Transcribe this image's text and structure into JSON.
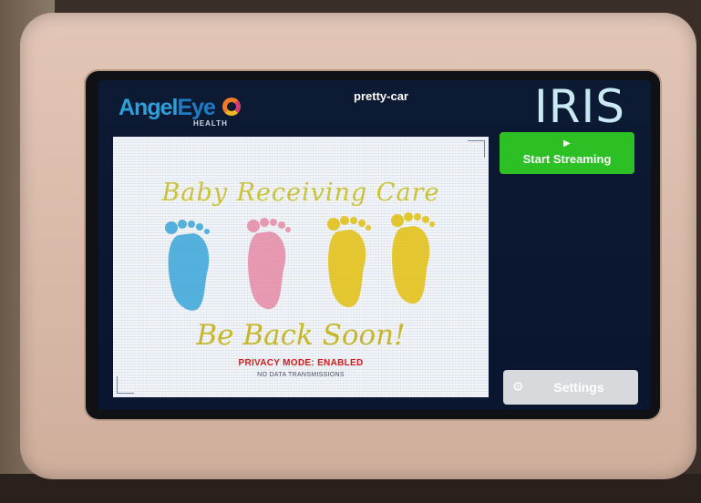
{
  "header": {
    "logo_primary_a": "Angel",
    "logo_primary_b": "Eye",
    "logo_sub": "HEALTH",
    "device_name": "pretty-car",
    "brand": "IRIS"
  },
  "controls": {
    "start_streaming_label": "Start Streaming",
    "start_streaming_icon": "play-icon",
    "settings_label": "Settings",
    "settings_icon": "gear-icon"
  },
  "preview": {
    "headline": "Baby Receiving Care",
    "tagline": "Be Back Soon!",
    "privacy_status": "PRIVACY MODE: ENABLED",
    "transmission_status": "NO DATA TRANSMISSIONS",
    "footprint_colors": [
      "#3aa6d8",
      "#e58aa6",
      "#e2c21c",
      "#e2c21c"
    ]
  },
  "colors": {
    "stream_button": "#2cc025",
    "settings_button": "#d7d9dd",
    "screen_background": "#0d1a33",
    "brand_text": "#c9eaf5"
  }
}
